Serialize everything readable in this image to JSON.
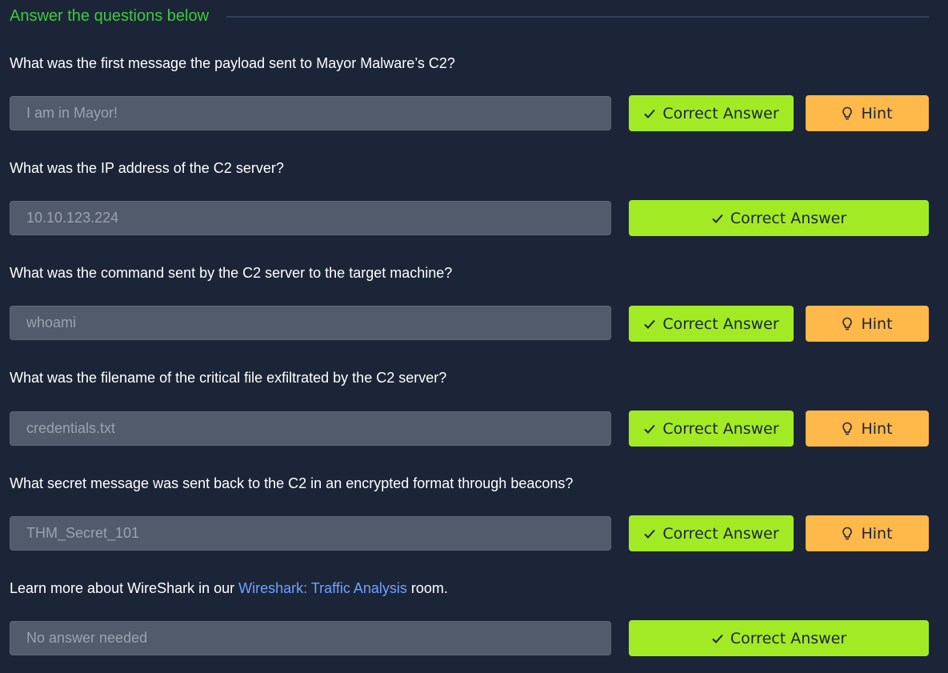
{
  "section": {
    "title": "Answer the questions below"
  },
  "questions": [
    {
      "text": "What was the first message the payload sent to Mayor Malware’s C2?",
      "answer": "I am in Mayor!",
      "correct_label": "Correct Answer",
      "hint_label": "Hint"
    },
    {
      "text": "What was the IP address of the C2 server?",
      "answer": "10.10.123.224",
      "correct_label": "Correct Answer"
    },
    {
      "text": "What was the command sent by the C2 server to the target machine?",
      "answer": "whoami",
      "correct_label": "Correct Answer",
      "hint_label": "Hint"
    },
    {
      "text": "What was the filename of the critical file exfiltrated by the C2 server?",
      "answer": "credentials.txt",
      "correct_label": "Correct Answer",
      "hint_label": "Hint"
    },
    {
      "text": "What secret message was sent back to the C2 in an encrypted format through beacons?",
      "answer": "THM_Secret_101",
      "correct_label": "Correct Answer",
      "hint_label": "Hint"
    },
    {
      "text_before": "Learn more about WireShark in our ",
      "link_text": "Wireshark: Traffic Analysis",
      "text_after": " room.",
      "answer": "No answer needed",
      "correct_label": "Correct Answer"
    }
  ],
  "icons": {
    "check": "check-icon",
    "hint": "lightbulb-icon"
  },
  "colors": {
    "background": "#1c2538",
    "header": "#3ec93e",
    "correct": "#a2eb24",
    "hint": "#ffb84a",
    "link": "#6ea2ff"
  }
}
